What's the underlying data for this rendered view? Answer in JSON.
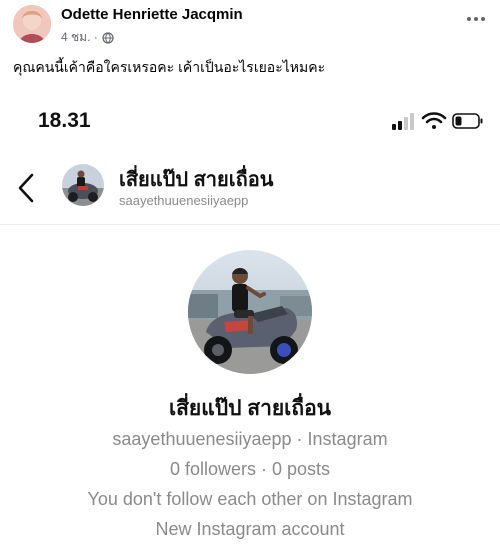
{
  "post": {
    "author": "Odette Henriette Jacqmin",
    "time": "4 ชม. ·",
    "text": "คุณคนนี้เค้าคือใครเหรอคะ เค้าเป็นอะไรเยอะไหมคะ"
  },
  "screenshot": {
    "status_time": "18.31",
    "profile": {
      "name": "เสี่ยแป๊ป สายเถื่อน",
      "handle": "saayethuuenesiiyaepp",
      "handle_line": "saayethuuenesiiyaepp · Instagram",
      "stats": "0 followers · 0 posts",
      "follow_note": "You don't follow each other on Instagram",
      "account_note": "New Instagram account"
    }
  },
  "icons": {
    "globe": "globe-icon",
    "more": "more-options-icon",
    "back": "chevron-left-icon",
    "signal": "signal-icon",
    "wifi": "wifi-icon",
    "battery": "battery-icon"
  },
  "colors": {
    "text_primary": "#050505",
    "text_secondary": "#65676b",
    "muted_gray": "#8a8a8a"
  }
}
